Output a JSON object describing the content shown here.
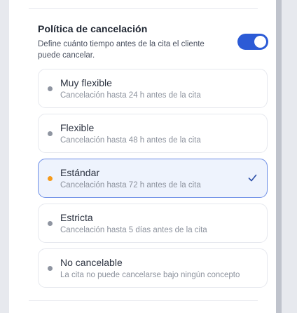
{
  "cancellation_policy": {
    "title": "Política de cancelación",
    "description": "Define cuánto tiempo antes de la cita el cliente puede cancelar.",
    "enabled": true,
    "options": [
      {
        "label": "Muy flexible",
        "description": "Cancelación hasta 24 h antes de la cita",
        "selected": false
      },
      {
        "label": "Flexible",
        "description": "Cancelación hasta 48 h antes de la cita",
        "selected": false
      },
      {
        "label": "Estándar",
        "description": "Cancelación hasta 72 h antes de la cita",
        "selected": true
      },
      {
        "label": "Estricta",
        "description": "Cancelación hasta 5 días antes de la cita",
        "selected": false
      },
      {
        "label": "No cancelable",
        "description": "La cita no puede cancelarse bajo ningún concepto",
        "selected": false
      }
    ]
  },
  "colors": {
    "accent": "#2c5bd6",
    "selected_dot": "#f59a1b",
    "unselected_dot": "#8f95a1",
    "selected_border": "#6d8ee6",
    "selected_background": "#eef3fd"
  },
  "icons": {
    "selected_indicator": "check-icon",
    "option_marker": "dot-icon"
  }
}
